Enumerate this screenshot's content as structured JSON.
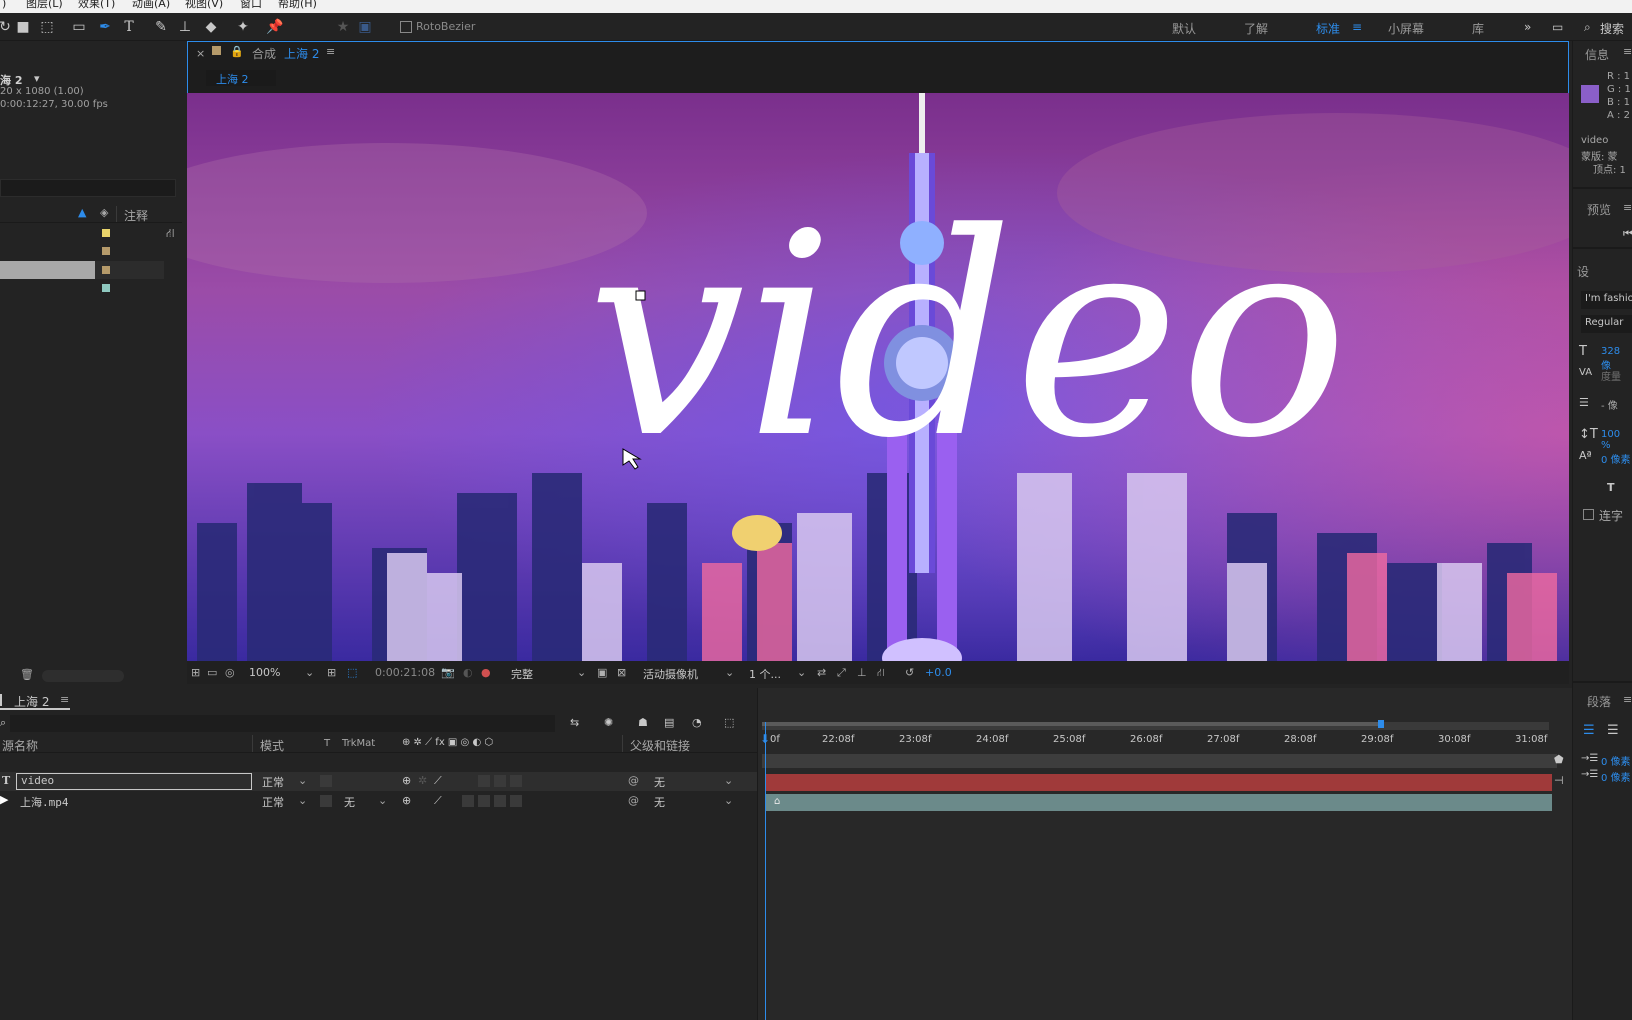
{
  "menu": {
    "items": [
      "图层(L)",
      "效果(T)",
      "动画(A)",
      "视图(V)",
      "窗口",
      "帮助(H)"
    ]
  },
  "toolbar": {
    "rotobezier_label": "RotoBezier",
    "workspaces": [
      "默认",
      "了解",
      "标准",
      "小屏幕",
      "库"
    ],
    "active_workspace": "标准",
    "search_label": "搜索"
  },
  "project": {
    "comp_name": "海 2",
    "comp_size": "20 x 1080 (1.00)",
    "comp_duration": "0:00:12:27, 30.00 fps",
    "col_comment": "注释",
    "label_colors": [
      "#e8d36a",
      "#b59a6a",
      "#b59a6a",
      "#8fc9c0"
    ]
  },
  "viewer": {
    "tab_prefix": "合成",
    "tab_comp": "上海 2",
    "breadcrumb": "上海 2",
    "overlay_text": "video",
    "zoom": "100%",
    "timecode": "0:00:21:08",
    "resolution": "完整",
    "camera": "活动摄像机",
    "views": "1 个...",
    "exposure": "+0.0"
  },
  "info_panel": {
    "title": "信息",
    "r": "R : 1",
    "g": "G : 1",
    "b": "B : 1",
    "a": "A : 2",
    "layer": "video",
    "mask": "蒙版: 蒙",
    "vertex": "顶点: 1",
    "swatch": "#8a5fc8"
  },
  "preview_panel": {
    "title": "预览"
  },
  "char_panel": {
    "title": "设",
    "font": "I'm fashio",
    "style": "Regular",
    "size": "328 像",
    "tracking": "度量",
    "leading": "- 像",
    "scale": "100 %",
    "baseline": "0 像素",
    "ligature": "连字"
  },
  "para_panel": {
    "title": "段落",
    "indent1": "0 像素",
    "indent2": "0 像素"
  },
  "timeline": {
    "tab": "上海 2",
    "columns": {
      "name": "源名称",
      "mode": "模式",
      "t": "T",
      "trkmat": "TrkMat",
      "parent": "父级和链接"
    },
    "layers": [
      {
        "type": "T",
        "name": "video",
        "mode": "正常",
        "trkmat": "",
        "parent": "无"
      },
      {
        "type": "▶",
        "name": "上海.mp4",
        "mode": "正常",
        "trkmat": "无",
        "parent": "无"
      }
    ],
    "ruler": [
      "0f",
      "22:08f",
      "23:08f",
      "24:08f",
      "25:08f",
      "26:08f",
      "27:08f",
      "28:08f",
      "29:08f",
      "30:08f",
      "31:08f"
    ]
  }
}
